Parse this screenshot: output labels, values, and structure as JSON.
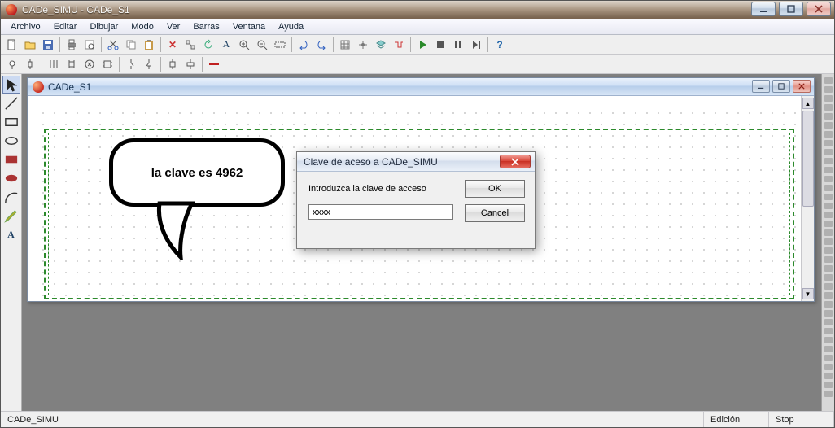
{
  "window": {
    "title": "CADe_SIMU - CADe_S1"
  },
  "menu": {
    "items": [
      "Archivo",
      "Editar",
      "Dibujar",
      "Modo",
      "Ver",
      "Barras",
      "Ventana",
      "Ayuda"
    ]
  },
  "toolbar1": {
    "buttons": [
      "new",
      "open",
      "save",
      "sep",
      "print",
      "print-preview",
      "sep",
      "cut",
      "copy",
      "paste",
      "sep",
      "delete",
      "match",
      "rotate",
      "text-tool",
      "zoom-in",
      "zoom-out",
      "zoom-rect",
      "sep",
      "undo",
      "redo",
      "sep",
      "grid",
      "snap",
      "layers",
      "wires",
      "sep",
      "play",
      "stop",
      "pause",
      "step",
      "sep",
      "help"
    ]
  },
  "toolbar2": {
    "buttons": [
      "lamp",
      "fuse",
      "sep",
      "multi-contact",
      "relay-coil",
      "motor",
      "chip",
      "sep",
      "switch-no",
      "switch-nc",
      "sep",
      "contactor",
      "timer",
      "sep",
      "draw-red-line"
    ]
  },
  "left_palette": {
    "buttons": [
      "pointer",
      "line",
      "rect",
      "ellipse",
      "disc",
      "filled-ellipse",
      "free-ellipse",
      "pencil",
      "text"
    ]
  },
  "child": {
    "title": "CADe_S1"
  },
  "bubble": {
    "text": "la clave es 4962"
  },
  "dialog": {
    "title": "Clave de aceso a CADe_SIMU",
    "prompt": "Introduzca la clave de acceso",
    "input_value": "xxxx",
    "ok_label": "OK",
    "cancel_label": "Cancel"
  },
  "statusbar": {
    "left": "CADe_SIMU",
    "mid": "Edición",
    "right": "Stop"
  }
}
